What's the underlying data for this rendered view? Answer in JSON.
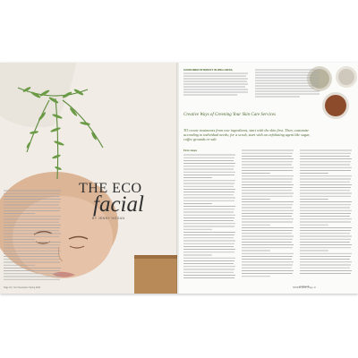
{
  "article": {
    "title_line1": "THE ECO",
    "title_line2": "facial",
    "byline": "BY JENNY HOGAN",
    "subtitle": "Creative Ways of Greening Your Skin Care Services",
    "intro_label": "CONSUMER INTEREST IN WELLNESS,",
    "lead_quote": "TO create treatments from raw ingredients, start with the skin first. Then, customize according to individual needs; for a scrub, start with an exfoliating agent like sugar, coffee grounds or salt.",
    "section_heading": "First steps",
    "continued": "continued",
    "folio_left": "Page 10 | Your Newsletter Spring 2023",
    "folio_right": "SPRING 2023 | Page 11"
  },
  "colors": {
    "accent_green": "#4e6b34",
    "leaf_green": "#5c8a3a",
    "skin": "#e6c2a8",
    "wood": "#a87a4a"
  },
  "icons": [
    "fern-illustration",
    "spice-bowl-icon"
  ]
}
